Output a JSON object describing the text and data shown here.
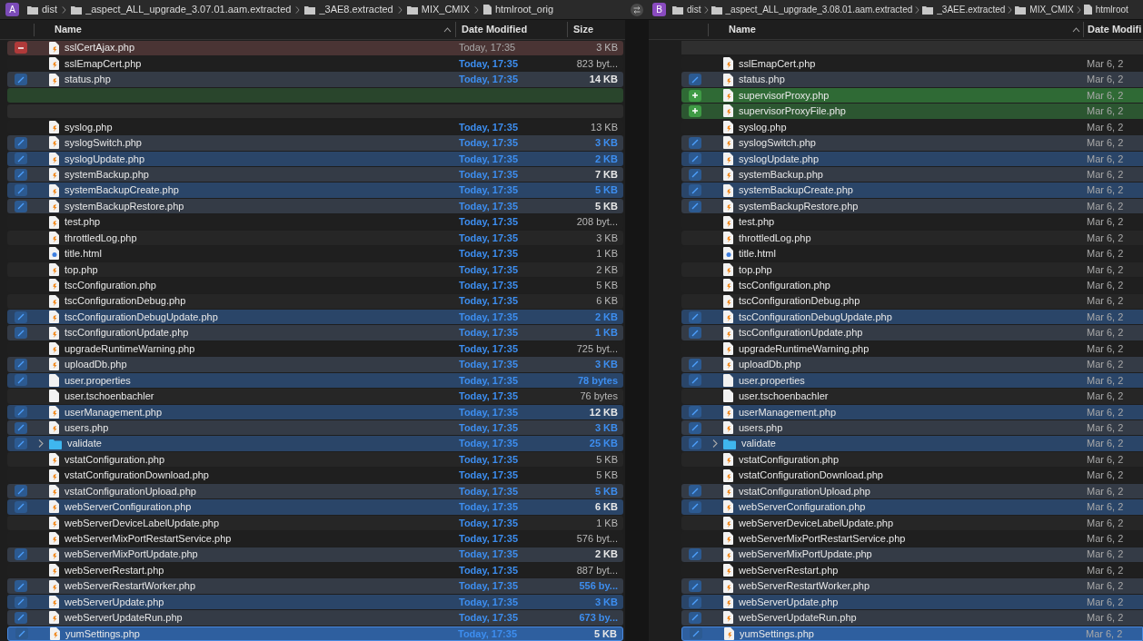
{
  "left_pane": {
    "badge": "A",
    "path": [
      {
        "name": "dist",
        "kind": "folder"
      },
      {
        "name": "_aspect_ALL_upgrade_3.07.01.aam.extracted",
        "kind": "folder"
      },
      {
        "name": "_3AE8.extracted",
        "kind": "folder"
      },
      {
        "name": "MIX_CMIX",
        "kind": "folder"
      },
      {
        "name": "htmlroot_orig",
        "kind": "file"
      }
    ],
    "columns": [
      "Name",
      "Date Modified",
      "Size"
    ]
  },
  "right_pane": {
    "badge": "B",
    "path": [
      {
        "name": "dist",
        "kind": "folder"
      },
      {
        "name": "_aspect_ALL_upgrade_3.08.01.aam.extracted",
        "kind": "folder"
      },
      {
        "name": "_3AEE.extracted",
        "kind": "folder"
      },
      {
        "name": "MIX_CMIX",
        "kind": "folder"
      },
      {
        "name": "htmlroot",
        "kind": "file"
      }
    ],
    "columns": [
      "Name",
      "Date Modifi"
    ]
  },
  "rows": [
    {
      "kind": "removed",
      "selected": false,
      "left": {
        "name": "sslCertAjax.php",
        "kind": "php",
        "date": "Today, 17:35",
        "size": "3 KB",
        "size_changed": false
      },
      "right": null
    },
    {
      "kind": "same",
      "selected": false,
      "left": {
        "name": "sslEmapCert.php",
        "kind": "php",
        "date": "Today, 17:35",
        "size": "823 byt...",
        "size_changed": false
      },
      "right": {
        "name": "sslEmapCert.php",
        "kind": "php",
        "date": "Mar 6, 2"
      }
    },
    {
      "kind": "modified",
      "selected": false,
      "left": {
        "name": "status.php",
        "kind": "php",
        "date": "Today, 17:35",
        "size": "14 KB",
        "size_changed": false
      },
      "right": {
        "name": "status.php",
        "kind": "php",
        "date": "Mar 6, 2"
      }
    },
    {
      "kind": "added",
      "selected": false,
      "left": null,
      "right": {
        "name": "supervisorProxy.php",
        "kind": "php",
        "date": "Mar 6, 2"
      }
    },
    {
      "kind": "added",
      "selected": false,
      "left": null,
      "right": {
        "name": "supervisorProxyFile.php",
        "kind": "php",
        "date": "Mar 6, 2"
      }
    },
    {
      "kind": "same",
      "selected": false,
      "left": {
        "name": "syslog.php",
        "kind": "php",
        "date": "Today, 17:35",
        "size": "13 KB",
        "size_changed": false
      },
      "right": {
        "name": "syslog.php",
        "kind": "php",
        "date": "Mar 6, 2"
      }
    },
    {
      "kind": "modified",
      "selected": false,
      "left": {
        "name": "syslogSwitch.php",
        "kind": "php",
        "date": "Today, 17:35",
        "size": "3 KB",
        "size_changed": true
      },
      "right": {
        "name": "syslogSwitch.php",
        "kind": "php",
        "date": "Mar 6, 2"
      }
    },
    {
      "kind": "modified",
      "selected": false,
      "left": {
        "name": "syslogUpdate.php",
        "kind": "php",
        "date": "Today, 17:35",
        "size": "2 KB",
        "size_changed": true
      },
      "right": {
        "name": "syslogUpdate.php",
        "kind": "php",
        "date": "Mar 6, 2"
      }
    },
    {
      "kind": "modified",
      "selected": false,
      "left": {
        "name": "systemBackup.php",
        "kind": "php",
        "date": "Today, 17:35",
        "size": "7 KB",
        "size_changed": false
      },
      "right": {
        "name": "systemBackup.php",
        "kind": "php",
        "date": "Mar 6, 2"
      }
    },
    {
      "kind": "modified",
      "selected": false,
      "left": {
        "name": "systemBackupCreate.php",
        "kind": "php",
        "date": "Today, 17:35",
        "size": "5 KB",
        "size_changed": true
      },
      "right": {
        "name": "systemBackupCreate.php",
        "kind": "php",
        "date": "Mar 6, 2"
      }
    },
    {
      "kind": "modified",
      "selected": false,
      "left": {
        "name": "systemBackupRestore.php",
        "kind": "php",
        "date": "Today, 17:35",
        "size": "5 KB",
        "size_changed": false
      },
      "right": {
        "name": "systemBackupRestore.php",
        "kind": "php",
        "date": "Mar 6, 2"
      }
    },
    {
      "kind": "same",
      "selected": false,
      "left": {
        "name": "test.php",
        "kind": "php",
        "date": "Today, 17:35",
        "size": "208 byt...",
        "size_changed": false
      },
      "right": {
        "name": "test.php",
        "kind": "php",
        "date": "Mar 6, 2"
      }
    },
    {
      "kind": "same",
      "selected": false,
      "left": {
        "name": "throttledLog.php",
        "kind": "php",
        "date": "Today, 17:35",
        "size": "3 KB",
        "size_changed": false
      },
      "right": {
        "name": "throttledLog.php",
        "kind": "php",
        "date": "Mar 6, 2"
      }
    },
    {
      "kind": "same",
      "selected": false,
      "left": {
        "name": "title.html",
        "kind": "html",
        "date": "Today, 17:35",
        "size": "1 KB",
        "size_changed": false
      },
      "right": {
        "name": "title.html",
        "kind": "html",
        "date": "Mar 6, 2"
      }
    },
    {
      "kind": "same",
      "selected": false,
      "left": {
        "name": "top.php",
        "kind": "php",
        "date": "Today, 17:35",
        "size": "2 KB",
        "size_changed": false
      },
      "right": {
        "name": "top.php",
        "kind": "php",
        "date": "Mar 6, 2"
      }
    },
    {
      "kind": "same",
      "selected": false,
      "left": {
        "name": "tscConfiguration.php",
        "kind": "php",
        "date": "Today, 17:35",
        "size": "5 KB",
        "size_changed": false
      },
      "right": {
        "name": "tscConfiguration.php",
        "kind": "php",
        "date": "Mar 6, 2"
      }
    },
    {
      "kind": "same",
      "selected": false,
      "left": {
        "name": "tscConfigurationDebug.php",
        "kind": "php",
        "date": "Today, 17:35",
        "size": "6 KB",
        "size_changed": false
      },
      "right": {
        "name": "tscConfigurationDebug.php",
        "kind": "php",
        "date": "Mar 6, 2"
      }
    },
    {
      "kind": "modified",
      "selected": false,
      "left": {
        "name": "tscConfigurationDebugUpdate.php",
        "kind": "php",
        "date": "Today, 17:35",
        "size": "2 KB",
        "size_changed": true
      },
      "right": {
        "name": "tscConfigurationDebugUpdate.php",
        "kind": "php",
        "date": "Mar 6, 2"
      }
    },
    {
      "kind": "modified",
      "selected": false,
      "left": {
        "name": "tscConfigurationUpdate.php",
        "kind": "php",
        "date": "Today, 17:35",
        "size": "1 KB",
        "size_changed": true
      },
      "right": {
        "name": "tscConfigurationUpdate.php",
        "kind": "php",
        "date": "Mar 6, 2"
      }
    },
    {
      "kind": "same",
      "selected": false,
      "left": {
        "name": "upgradeRuntimeWarning.php",
        "kind": "php",
        "date": "Today, 17:35",
        "size": "725 byt...",
        "size_changed": false
      },
      "right": {
        "name": "upgradeRuntimeWarning.php",
        "kind": "php",
        "date": "Mar 6, 2"
      }
    },
    {
      "kind": "modified",
      "selected": false,
      "left": {
        "name": "uploadDb.php",
        "kind": "php",
        "date": "Today, 17:35",
        "size": "3 KB",
        "size_changed": true
      },
      "right": {
        "name": "uploadDb.php",
        "kind": "php",
        "date": "Mar 6, 2"
      }
    },
    {
      "kind": "modified",
      "selected": false,
      "left": {
        "name": "user.properties",
        "kind": "file",
        "date": "Today, 17:35",
        "size": "78 bytes",
        "size_changed": true
      },
      "right": {
        "name": "user.properties",
        "kind": "file",
        "date": "Mar 6, 2"
      }
    },
    {
      "kind": "same",
      "selected": false,
      "left": {
        "name": "user.tschoenbachler",
        "kind": "file",
        "date": "Today, 17:35",
        "size": "76 bytes",
        "size_changed": false
      },
      "right": {
        "name": "user.tschoenbachler",
        "kind": "file",
        "date": "Mar 6, 2"
      }
    },
    {
      "kind": "modified",
      "selected": false,
      "left": {
        "name": "userManagement.php",
        "kind": "php",
        "date": "Today, 17:35",
        "size": "12 KB",
        "size_changed": false
      },
      "right": {
        "name": "userManagement.php",
        "kind": "php",
        "date": "Mar 6, 2"
      }
    },
    {
      "kind": "modified",
      "selected": false,
      "left": {
        "name": "users.php",
        "kind": "php",
        "date": "Today, 17:35",
        "size": "3 KB",
        "size_changed": true
      },
      "right": {
        "name": "users.php",
        "kind": "php",
        "date": "Mar 6, 2"
      }
    },
    {
      "kind": "modified",
      "selected": false,
      "left": {
        "name": "validate",
        "kind": "folder",
        "expanded": false,
        "date": "Today, 17:35",
        "size": "25 KB",
        "size_changed": true
      },
      "right": {
        "name": "validate",
        "kind": "folder",
        "expanded": false,
        "date": "Mar 6, 2"
      }
    },
    {
      "kind": "same",
      "selected": false,
      "left": {
        "name": "vstatConfiguration.php",
        "kind": "php",
        "date": "Today, 17:35",
        "size": "5 KB",
        "size_changed": false
      },
      "right": {
        "name": "vstatConfiguration.php",
        "kind": "php",
        "date": "Mar 6, 2"
      }
    },
    {
      "kind": "same",
      "selected": false,
      "left": {
        "name": "vstatConfigurationDownload.php",
        "kind": "php",
        "date": "Today, 17:35",
        "size": "5 KB",
        "size_changed": false
      },
      "right": {
        "name": "vstatConfigurationDownload.php",
        "kind": "php",
        "date": "Mar 6, 2"
      }
    },
    {
      "kind": "modified",
      "selected": false,
      "left": {
        "name": "vstatConfigurationUpload.php",
        "kind": "php",
        "date": "Today, 17:35",
        "size": "5 KB",
        "size_changed": true
      },
      "right": {
        "name": "vstatConfigurationUpload.php",
        "kind": "php",
        "date": "Mar 6, 2"
      }
    },
    {
      "kind": "modified",
      "selected": false,
      "left": {
        "name": "webServerConfiguration.php",
        "kind": "php",
        "date": "Today, 17:35",
        "size": "6 KB",
        "size_changed": false
      },
      "right": {
        "name": "webServerConfiguration.php",
        "kind": "php",
        "date": "Mar 6, 2"
      }
    },
    {
      "kind": "same",
      "selected": false,
      "left": {
        "name": "webServerDeviceLabelUpdate.php",
        "kind": "php",
        "date": "Today, 17:35",
        "size": "1 KB",
        "size_changed": false
      },
      "right": {
        "name": "webServerDeviceLabelUpdate.php",
        "kind": "php",
        "date": "Mar 6, 2"
      }
    },
    {
      "kind": "same",
      "selected": false,
      "left": {
        "name": "webServerMixPortRestartService.php",
        "kind": "php",
        "date": "Today, 17:35",
        "size": "576 byt...",
        "size_changed": false
      },
      "right": {
        "name": "webServerMixPortRestartService.php",
        "kind": "php",
        "date": "Mar 6, 2"
      }
    },
    {
      "kind": "modified",
      "selected": false,
      "left": {
        "name": "webServerMixPortUpdate.php",
        "kind": "php",
        "date": "Today, 17:35",
        "size": "2 KB",
        "size_changed": false
      },
      "right": {
        "name": "webServerMixPortUpdate.php",
        "kind": "php",
        "date": "Mar 6, 2"
      }
    },
    {
      "kind": "same",
      "selected": false,
      "left": {
        "name": "webServerRestart.php",
        "kind": "php",
        "date": "Today, 17:35",
        "size": "887 byt...",
        "size_changed": false
      },
      "right": {
        "name": "webServerRestart.php",
        "kind": "php",
        "date": "Mar 6, 2"
      }
    },
    {
      "kind": "modified",
      "selected": false,
      "left": {
        "name": "webServerRestartWorker.php",
        "kind": "php",
        "date": "Today, 17:35",
        "size": "556 by...",
        "size_changed": true
      },
      "right": {
        "name": "webServerRestartWorker.php",
        "kind": "php",
        "date": "Mar 6, 2"
      }
    },
    {
      "kind": "modified",
      "selected": false,
      "left": {
        "name": "webServerUpdate.php",
        "kind": "php",
        "date": "Today, 17:35",
        "size": "3 KB",
        "size_changed": true
      },
      "right": {
        "name": "webServerUpdate.php",
        "kind": "php",
        "date": "Mar 6, 2"
      }
    },
    {
      "kind": "modified",
      "selected": false,
      "left": {
        "name": "webServerUpdateRun.php",
        "kind": "php",
        "date": "Today, 17:35",
        "size": "673 by...",
        "size_changed": true
      },
      "right": {
        "name": "webServerUpdateRun.php",
        "kind": "php",
        "date": "Mar 6, 2"
      }
    },
    {
      "kind": "modified",
      "selected": true,
      "left": {
        "name": "yumSettings.php",
        "kind": "php",
        "date": "Today, 17:35",
        "size": "5 KB",
        "size_changed": false
      },
      "right": {
        "name": "yumSettings.php",
        "kind": "php",
        "date": "Mar 6, 2"
      }
    }
  ]
}
